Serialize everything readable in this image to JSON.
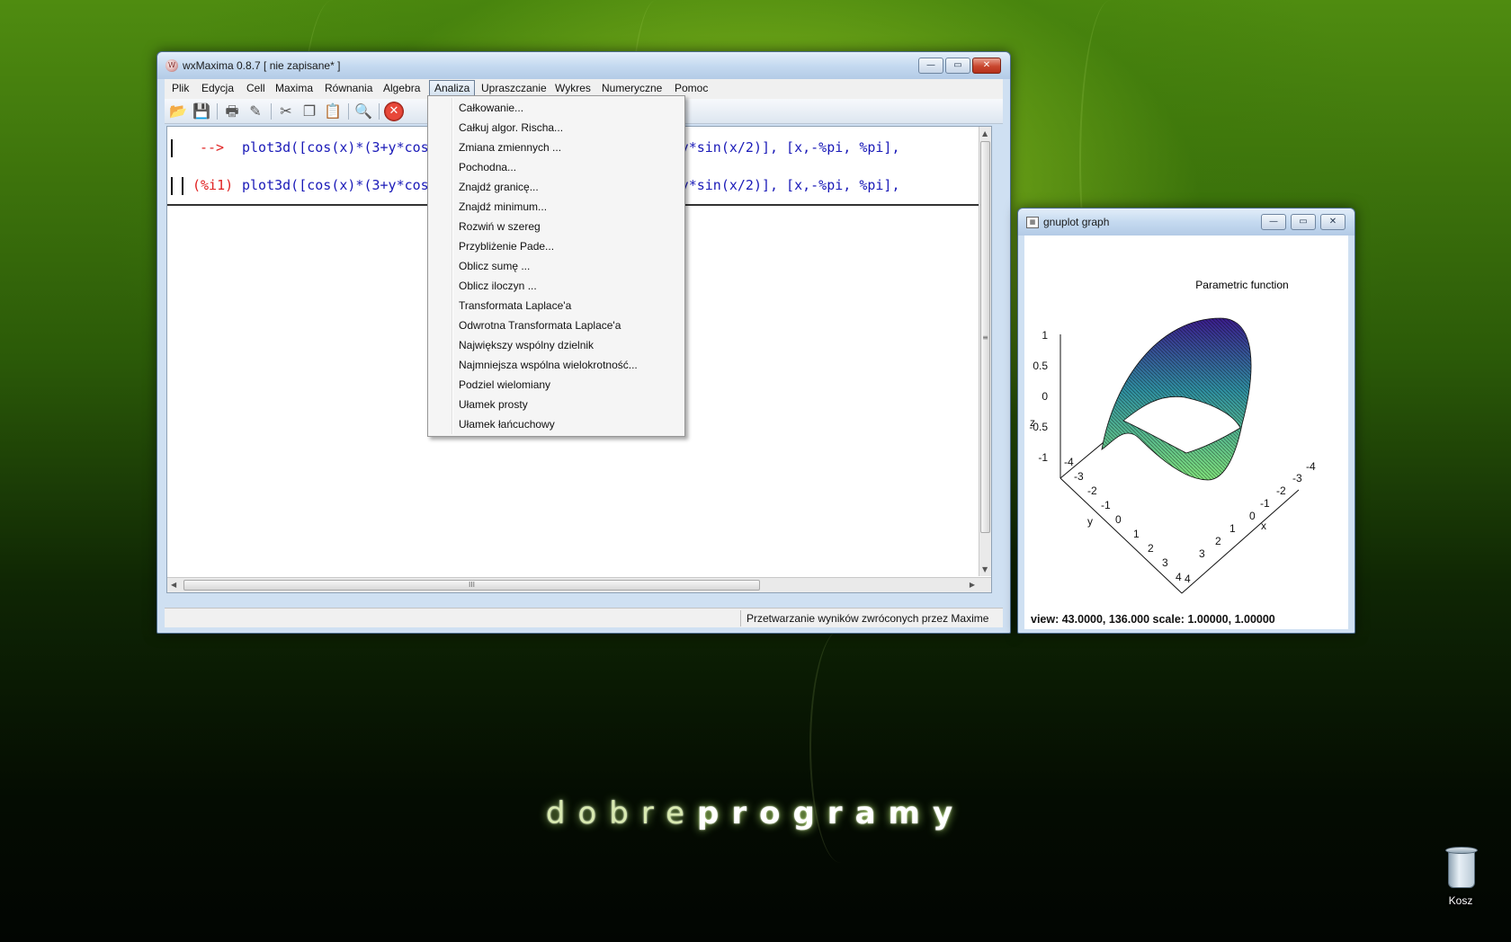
{
  "wxmaxima": {
    "title": "wxMaxima 0.8.7 [ nie zapisane* ]",
    "menu": [
      "Plik",
      "Edycja",
      "Cell",
      "Maxima",
      "Równania",
      "Algebra",
      "Analiza",
      "Upraszczanie",
      "Wykres",
      "Numeryczne",
      "Pomoc"
    ],
    "active_menu": "Analiza",
    "toolbar_icons": [
      "open-icon",
      "save-icon",
      "print-icon",
      "config-icon",
      "cut-icon",
      "copy-icon",
      "paste-icon",
      "find-icon",
      "stop-icon"
    ],
    "cells": [
      {
        "prompt": "-->",
        "code": "plot3d([cos(x)*(3+y*cos(x/2)), sin(x)*(3+y*cos(x/2)), y*sin(x/2)], [x,-%pi, %pi],"
      },
      {
        "prompt": "(%i1)",
        "code": "plot3d([cos(x)*(3+y*cos(x/2)), sin(x)*(3+y*cos(x/2)), y*sin(x/2)], [x,-%pi, %pi],"
      }
    ],
    "status": "Przetwarzanie wyników zwróconych przez Maxime"
  },
  "analiza_menu": [
    "Całkowanie...",
    "Całkuj algor. Rischa...",
    "Zmiana zmiennych ...",
    "Pochodna...",
    "Znajdź granicę...",
    "Znajdź minimum...",
    "Rozwiń w szereg",
    "Przybliżenie Pade...",
    "Oblicz sumę ...",
    "Oblicz iloczyn ...",
    "Transformata Laplace'a",
    "Odwrotna Transformata Laplace'a",
    "Największy wspólny dzielnik",
    "Najmniejsza wspólna wielokrotność...",
    "Podziel wielomiany",
    "Ułamek prosty",
    "Ułamek łańcuchowy"
  ],
  "gnuplot": {
    "title": "gnuplot graph",
    "plot_title": "Parametric function",
    "status": "view:  43.0000,  136.000   scale:  1.00000,  1.00000",
    "z_label": "z",
    "x_label": "x",
    "y_label": "y",
    "z_ticks": [
      "1",
      "0.5",
      "0",
      "-0.5",
      "-1"
    ],
    "x_ticks": [
      "-4",
      "-3",
      "-2",
      "-1",
      "0",
      "1",
      "2",
      "3",
      "4"
    ],
    "y_ticks": [
      "-4",
      "-3",
      "-2",
      "-1",
      "0",
      "1",
      "2",
      "3",
      "4"
    ],
    "colors": {
      "top": "#3b1d8c",
      "mid": "#2f8fa0",
      "low": "#7fe07a"
    }
  },
  "desktop": {
    "brand_thin": "dobre",
    "brand_bold": "programy",
    "recycle_bin_label": "Kosz"
  },
  "window_buttons": {
    "minimize": "—",
    "maximize": "▭",
    "close": "✕"
  }
}
